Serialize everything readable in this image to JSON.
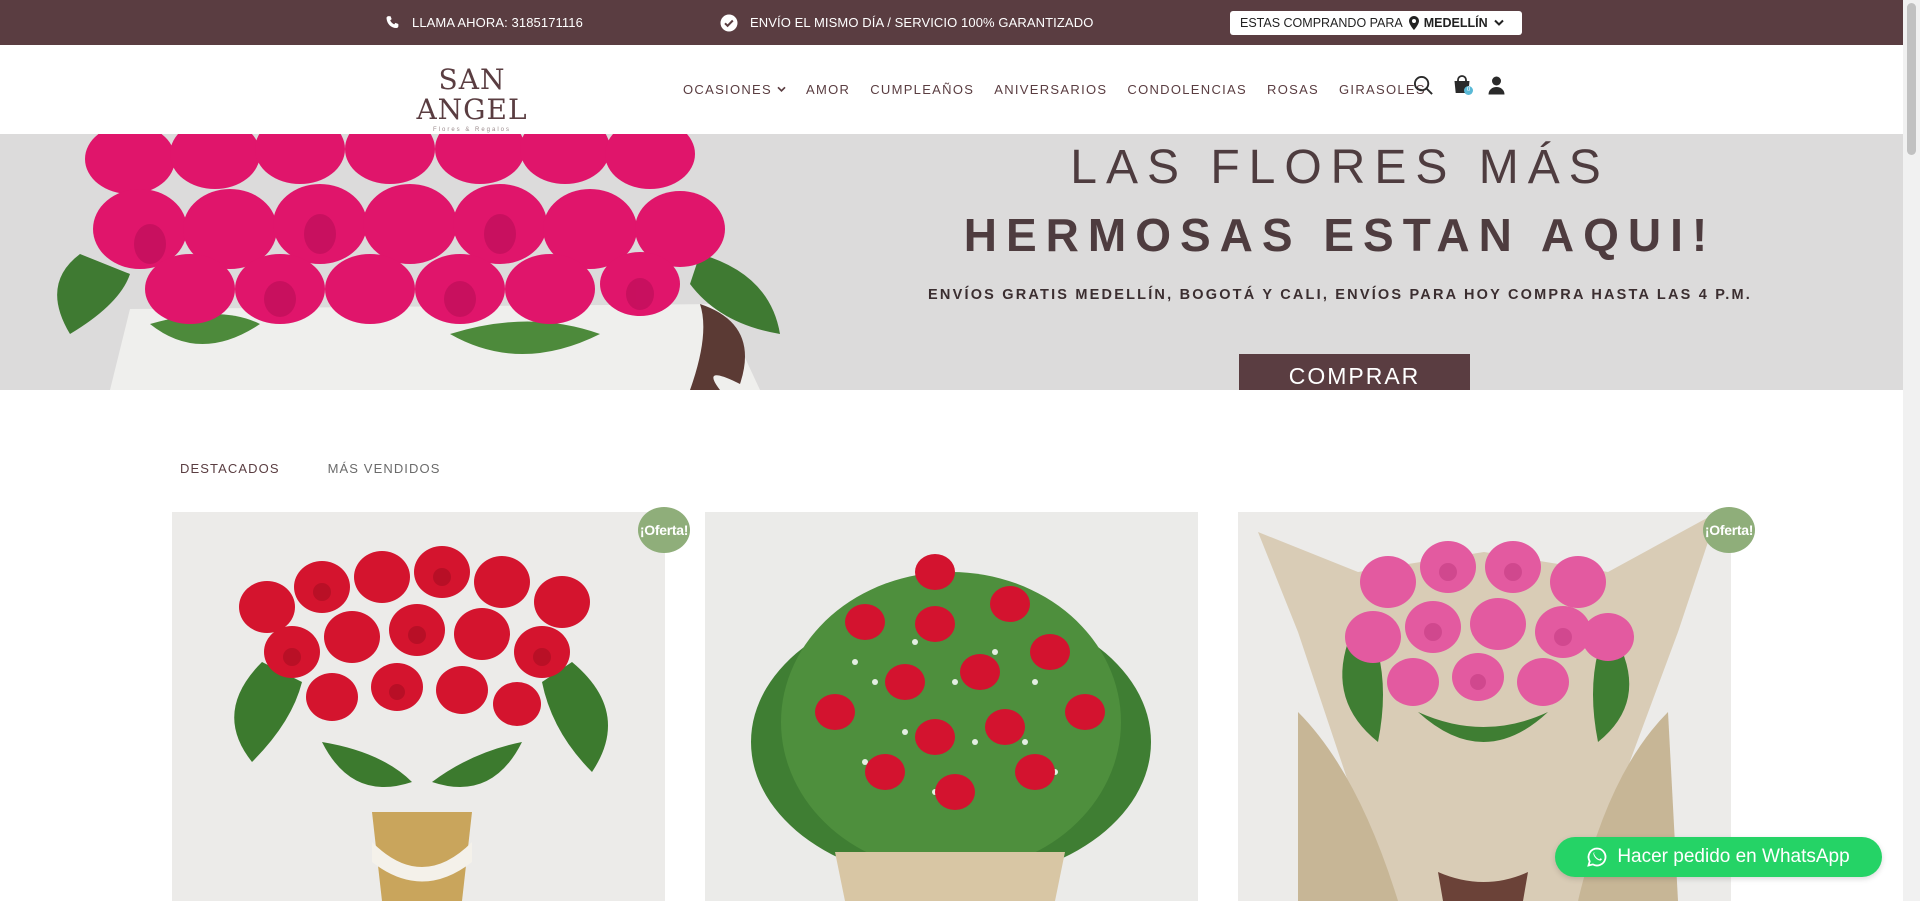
{
  "topbar": {
    "phone_label": "LLAMA AHORA: 3185171116",
    "shipping_label": "ENVÍO EL MISMO DÍA / SERVICIO 100% GARANTIZADO",
    "buying_for_label": "ESTAS COMPRANDO PARA",
    "city": "MEDELLÍN"
  },
  "header": {
    "logo_main": "SAN ANGEL",
    "logo_sub": "Flores & Regalos",
    "nav": [
      {
        "label": "OCASIONES"
      },
      {
        "label": "AMOR"
      },
      {
        "label": "CUMPLEAÑOS"
      },
      {
        "label": "ANIVERSARIOS"
      },
      {
        "label": "CONDOLENCIAS"
      },
      {
        "label": "ROSAS"
      },
      {
        "label": "GIRASOLES"
      }
    ],
    "cart_count": "0",
    "icons": [
      "search-icon",
      "cart-icon",
      "user-icon"
    ]
  },
  "hero": {
    "line1": "LAS FLORES MÁS",
    "line2": "HERMOSAS ESTAN AQUI!",
    "line3": "ENVÍOS GRATIS MEDELLÍN, BOGOTÁ Y CALI, ENVÍOS PARA HOY COMPRA HASTA LAS 4 P.M.",
    "button": "COMPRAR"
  },
  "tabs": [
    {
      "label": "DESTACADOS",
      "active": true
    },
    {
      "label": "MÁS VENDIDOS",
      "active": false
    }
  ],
  "products": [
    {
      "image": "red-roses-gold-vase",
      "badge": "¡Oferta!"
    },
    {
      "image": "red-roses-box-arrangement",
      "badge": ""
    },
    {
      "image": "pink-roses-wrapped-bouquet",
      "badge": "¡Oferta!"
    }
  ],
  "whatsapp": {
    "label": "Hacer pedido en WhatsApp"
  },
  "colors": {
    "brand": "#5a3d41",
    "offer_badge": "#8fae7a",
    "whatsapp": "#25d366",
    "hero_bg": "#dcdbdb"
  }
}
